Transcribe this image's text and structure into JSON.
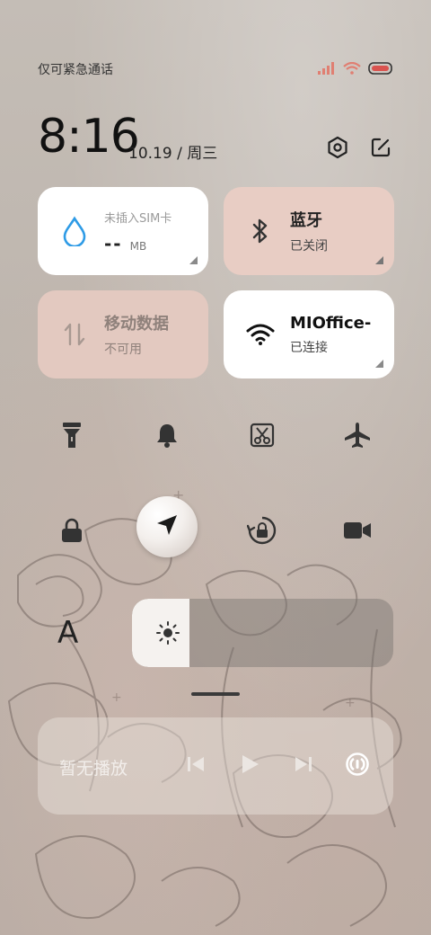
{
  "status": {
    "carrier_text": "仅可紧急通话",
    "icons": [
      "signal-icon",
      "wifi-icon",
      "battery-low-icon"
    ],
    "signal_color": "#e07f72",
    "battery_color": "#d9534f"
  },
  "header": {
    "time": "8:16",
    "date": "10.19 / 周三",
    "actions": [
      "settings-icon",
      "edit-icon"
    ]
  },
  "tiles": {
    "data_usage": {
      "label": "未插入SIM卡",
      "value": "--",
      "unit": "MB",
      "icon": "water-drop-icon",
      "accent": "#2e9be6"
    },
    "bluetooth": {
      "title": "蓝牙",
      "status": "已关闭",
      "icon": "bluetooth-icon"
    },
    "mobile_data": {
      "title": "移动数据",
      "status": "不可用",
      "icon": "data-arrows-icon"
    },
    "wifi": {
      "title": "MIOffice-",
      "status": "已连接",
      "icon": "wifi-icon"
    }
  },
  "toggles": [
    {
      "name": "flashlight",
      "icon": "flashlight-icon",
      "on": false
    },
    {
      "name": "ring",
      "icon": "bell-icon",
      "on": false
    },
    {
      "name": "screenshot",
      "icon": "screenshot-icon",
      "on": false
    },
    {
      "name": "airplane",
      "icon": "airplane-icon",
      "on": false
    },
    {
      "name": "lock",
      "icon": "lock-icon",
      "on": false
    },
    {
      "name": "location",
      "icon": "location-arrow-icon",
      "on": true
    },
    {
      "name": "rotation-lock",
      "icon": "rotation-lock-icon",
      "on": false
    },
    {
      "name": "screen-record",
      "icon": "video-camera-icon",
      "on": false
    }
  ],
  "brightness": {
    "font_button": "A",
    "icon": "sun-icon",
    "level_percent": 22
  },
  "media": {
    "label": "暂无播放",
    "controls": [
      "previous-icon",
      "play-icon",
      "next-icon",
      "cast-icon"
    ]
  }
}
